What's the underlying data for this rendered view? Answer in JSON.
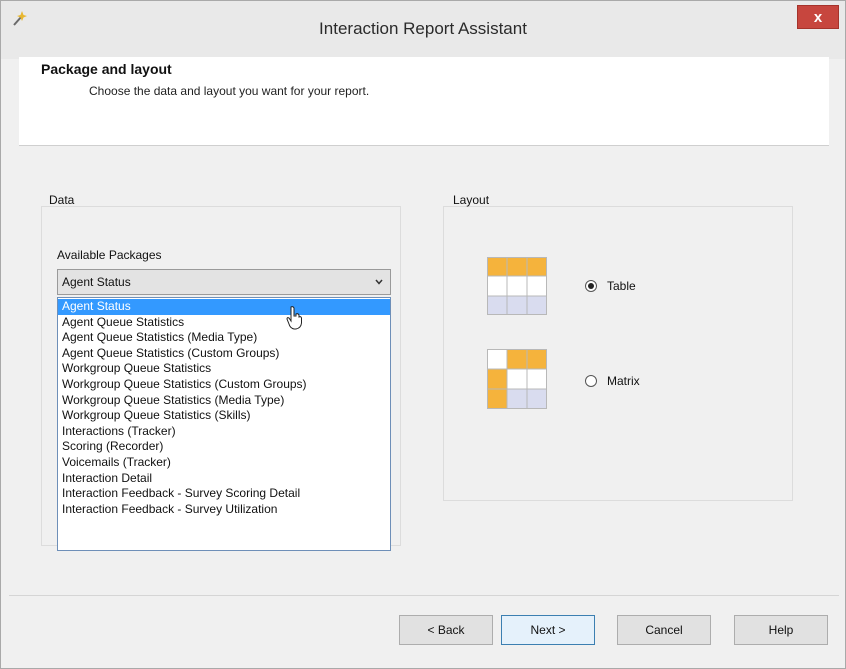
{
  "window": {
    "title": "Interaction Report Assistant",
    "close_label": "x"
  },
  "header": {
    "title": "Package and layout",
    "subtitle": "Choose the data and layout you want for your report."
  },
  "data_group": {
    "label": "Data",
    "packages_label": "Available Packages",
    "selected_value": "Agent Status",
    "options": [
      "Agent Status",
      "Agent Queue Statistics",
      "Agent Queue Statistics (Media Type)",
      "Agent Queue Statistics (Custom Groups)",
      "Workgroup Queue Statistics",
      "Workgroup Queue Statistics (Custom Groups)",
      "Workgroup Queue Statistics (Media Type)",
      "Workgroup Queue Statistics (Skills)",
      "Interactions (Tracker)",
      "Scoring (Recorder)",
      "Voicemails (Tracker)",
      "Interaction Detail",
      "Interaction Feedback - Survey Scoring Detail",
      "Interaction Feedback - Survey Utilization"
    ]
  },
  "layout_group": {
    "label": "Layout",
    "table_label": "Table",
    "matrix_label": "Matrix",
    "selected": "Table"
  },
  "footer": {
    "back_label": "< Back",
    "next_label": "Next >",
    "cancel_label": "Cancel",
    "help_label": "Help"
  },
  "colors": {
    "selection": "#3399ff",
    "close_button": "#c7463e",
    "icon_orange": "#f5b33c",
    "icon_lavender": "#d9dcef"
  }
}
